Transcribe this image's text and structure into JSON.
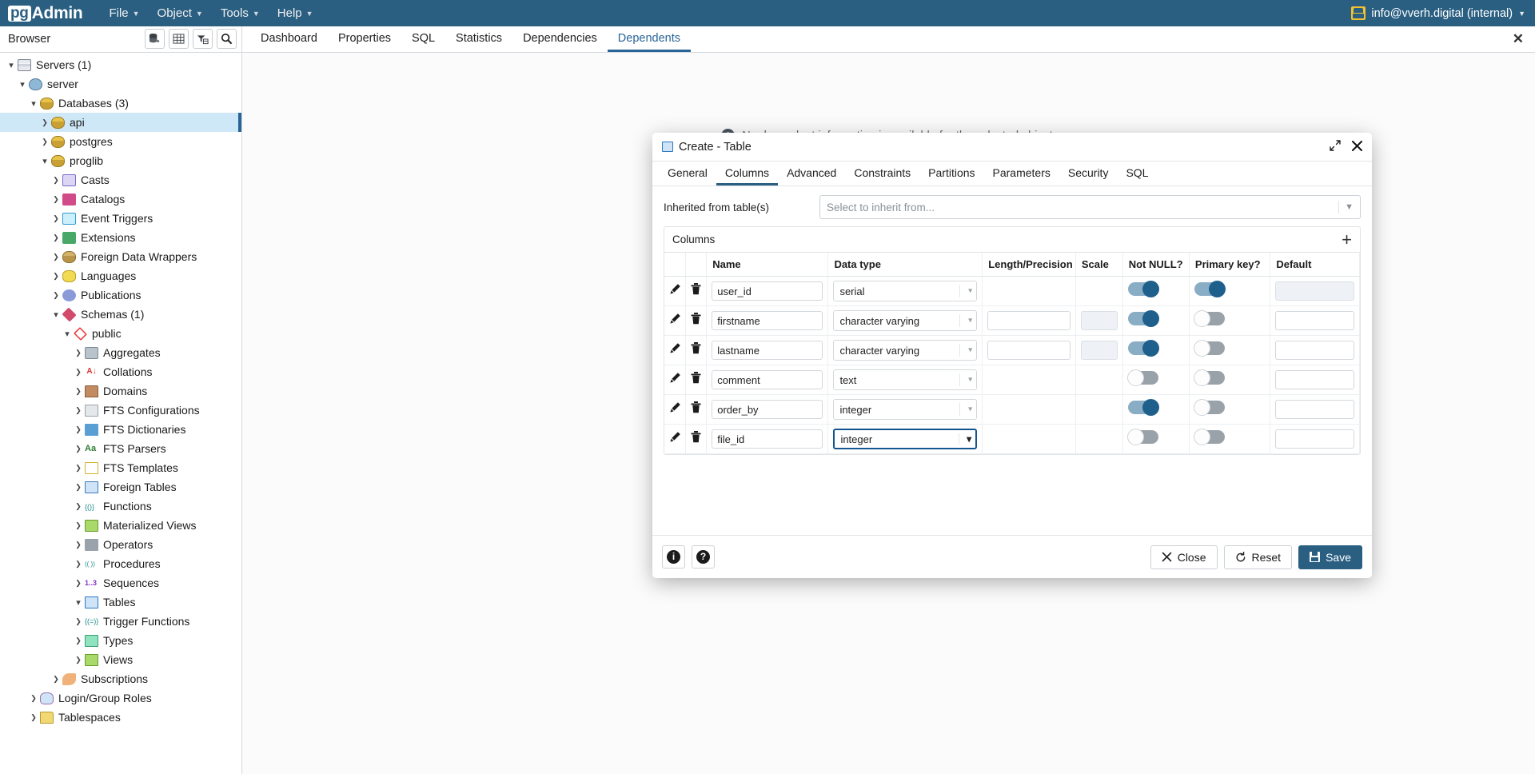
{
  "app": {
    "brand_pg": "pg",
    "brand_admin": "Admin",
    "accent_color": "#2a5f82",
    "menus": [
      {
        "label": "File",
        "icon": "chevron-down-icon"
      },
      {
        "label": "Object",
        "icon": "chevron-down-icon"
      },
      {
        "label": "Tools",
        "icon": "chevron-down-icon"
      },
      {
        "label": "Help",
        "icon": "chevron-down-icon"
      }
    ],
    "user": {
      "label": "info@vverh.digital (internal)",
      "icon": "user-icon",
      "caret": "chevron-down-icon"
    }
  },
  "browser": {
    "label": "Browser",
    "tools": [
      {
        "name": "object-explorer-icon"
      },
      {
        "name": "grid-icon"
      },
      {
        "name": "filter-icon"
      },
      {
        "name": "search-icon"
      }
    ]
  },
  "tabs": {
    "items": [
      {
        "label": "Dashboard",
        "active": false
      },
      {
        "label": "Properties",
        "active": false
      },
      {
        "label": "SQL",
        "active": false
      },
      {
        "label": "Statistics",
        "active": false
      },
      {
        "label": "Dependencies",
        "active": false
      },
      {
        "label": "Dependents",
        "active": true
      }
    ],
    "close_label": "✕"
  },
  "tree": [
    {
      "label": "Servers (1)",
      "indent": 0,
      "state": "open",
      "icon": "ic-servers"
    },
    {
      "label": "server",
      "indent": 1,
      "state": "open",
      "icon": "ic-pg"
    },
    {
      "label": "Databases (3)",
      "indent": 2,
      "state": "open",
      "icon": "ic-db"
    },
    {
      "label": "api",
      "indent": 3,
      "state": "closed",
      "icon": "ic-db",
      "selected": true
    },
    {
      "label": "postgres",
      "indent": 3,
      "state": "closed",
      "icon": "ic-db"
    },
    {
      "label": "proglib",
      "indent": 3,
      "state": "open",
      "icon": "ic-db"
    },
    {
      "label": "Casts",
      "indent": 4,
      "state": "closed",
      "icon": "ic-cast"
    },
    {
      "label": "Catalogs",
      "indent": 4,
      "state": "closed",
      "icon": "ic-catalog"
    },
    {
      "label": "Event Triggers",
      "indent": 4,
      "state": "closed",
      "icon": "ic-event"
    },
    {
      "label": "Extensions",
      "indent": 4,
      "state": "closed",
      "icon": "ic-ext"
    },
    {
      "label": "Foreign Data Wrappers",
      "indent": 4,
      "state": "closed",
      "icon": "ic-fdw"
    },
    {
      "label": "Languages",
      "indent": 4,
      "state": "closed",
      "icon": "ic-lang"
    },
    {
      "label": "Publications",
      "indent": 4,
      "state": "closed",
      "icon": "ic-pub"
    },
    {
      "label": "Schemas (1)",
      "indent": 4,
      "state": "open",
      "icon": "ic-schema"
    },
    {
      "label": "public",
      "indent": 5,
      "state": "open",
      "icon": "ic-public"
    },
    {
      "label": "Aggregates",
      "indent": 6,
      "state": "closed",
      "icon": "ic-agg"
    },
    {
      "label": "Collations",
      "indent": 6,
      "state": "closed",
      "icon": "ic-coll"
    },
    {
      "label": "Domains",
      "indent": 6,
      "state": "closed",
      "icon": "ic-dom"
    },
    {
      "label": "FTS Configurations",
      "indent": 6,
      "state": "closed",
      "icon": "ic-ftsc"
    },
    {
      "label": "FTS Dictionaries",
      "indent": 6,
      "state": "closed",
      "icon": "ic-ftsd"
    },
    {
      "label": "FTS Parsers",
      "indent": 6,
      "state": "closed",
      "icon": "ic-ftsp"
    },
    {
      "label": "FTS Templates",
      "indent": 6,
      "state": "closed",
      "icon": "ic-ftst"
    },
    {
      "label": "Foreign Tables",
      "indent": 6,
      "state": "closed",
      "icon": "ic-ftab"
    },
    {
      "label": "Functions",
      "indent": 6,
      "state": "closed",
      "icon": "ic-func"
    },
    {
      "label": "Materialized Views",
      "indent": 6,
      "state": "closed",
      "icon": "ic-matv"
    },
    {
      "label": "Operators",
      "indent": 6,
      "state": "closed",
      "icon": "ic-oper"
    },
    {
      "label": "Procedures",
      "indent": 6,
      "state": "closed",
      "icon": "ic-proc"
    },
    {
      "label": "Sequences",
      "indent": 6,
      "state": "closed",
      "icon": "ic-seq"
    },
    {
      "label": "Tables",
      "indent": 6,
      "state": "open",
      "icon": "ic-tab"
    },
    {
      "label": "Trigger Functions",
      "indent": 6,
      "state": "closed",
      "icon": "ic-trig"
    },
    {
      "label": "Types",
      "indent": 6,
      "state": "closed",
      "icon": "ic-type"
    },
    {
      "label": "Views",
      "indent": 6,
      "state": "closed",
      "icon": "ic-view"
    },
    {
      "label": "Subscriptions",
      "indent": 4,
      "state": "closed",
      "icon": "ic-sub"
    },
    {
      "label": "Login/Group Roles",
      "indent": 2,
      "state": "closed",
      "icon": "ic-role"
    },
    {
      "label": "Tablespaces",
      "indent": 2,
      "state": "closed",
      "icon": "ic-tspace"
    }
  ],
  "background": {
    "message": "No dependent information is available for the selected object."
  },
  "dialog": {
    "title": "Create - Table",
    "title_icon": "table-icon",
    "expand_icon": "expand-icon",
    "close_icon": "close-icon",
    "tabs": [
      {
        "label": "General",
        "active": false
      },
      {
        "label": "Columns",
        "active": true
      },
      {
        "label": "Advanced",
        "active": false
      },
      {
        "label": "Constraints",
        "active": false
      },
      {
        "label": "Partitions",
        "active": false
      },
      {
        "label": "Parameters",
        "active": false
      },
      {
        "label": "Security",
        "active": false
      },
      {
        "label": "SQL",
        "active": false
      }
    ],
    "inherited": {
      "label": "Inherited from table(s)",
      "placeholder": "Select to inherit from...",
      "value": "",
      "chevron": "chevron-down-icon"
    },
    "columns_panel": {
      "title": "Columns",
      "add_label": "+",
      "headers": [
        "",
        "",
        "Name",
        "Data type",
        "Length/Precision",
        "Scale",
        "Not NULL?",
        "Primary key?",
        "Default"
      ],
      "rows": [
        {
          "name": "user_id",
          "data_type": "serial",
          "length": null,
          "scale": null,
          "not_null": true,
          "primary_key": true,
          "default": "",
          "default_disabled": true,
          "type_focused": false
        },
        {
          "name": "firstname",
          "data_type": "character varying",
          "length": "",
          "scale": "",
          "scale_disabled": true,
          "not_null": true,
          "primary_key": false,
          "default": "",
          "default_disabled": false,
          "type_focused": false
        },
        {
          "name": "lastname",
          "data_type": "character varying",
          "length": "",
          "scale": "",
          "scale_disabled": true,
          "not_null": true,
          "primary_key": false,
          "default": "",
          "default_disabled": false,
          "type_focused": false
        },
        {
          "name": "comment",
          "data_type": "text",
          "length": null,
          "scale": null,
          "not_null": false,
          "primary_key": false,
          "default": "",
          "default_disabled": false,
          "type_focused": false
        },
        {
          "name": "order_by",
          "data_type": "integer",
          "length": null,
          "scale": null,
          "not_null": true,
          "primary_key": false,
          "default": "",
          "default_disabled": false,
          "type_focused": false
        },
        {
          "name": "file_id",
          "data_type": "integer",
          "length": null,
          "scale": null,
          "not_null": false,
          "primary_key": false,
          "default": "",
          "default_disabled": false,
          "type_focused": true
        }
      ],
      "row_icons": {
        "edit": "pencil-icon",
        "delete": "trash-icon"
      }
    },
    "footer": {
      "info_label": "i",
      "help_label": "?",
      "close_label": "Close",
      "reset_label": "Reset",
      "save_label": "Save",
      "close_icon": "x-icon",
      "reset_icon": "reset-icon",
      "save_icon": "floppy-icon"
    }
  }
}
